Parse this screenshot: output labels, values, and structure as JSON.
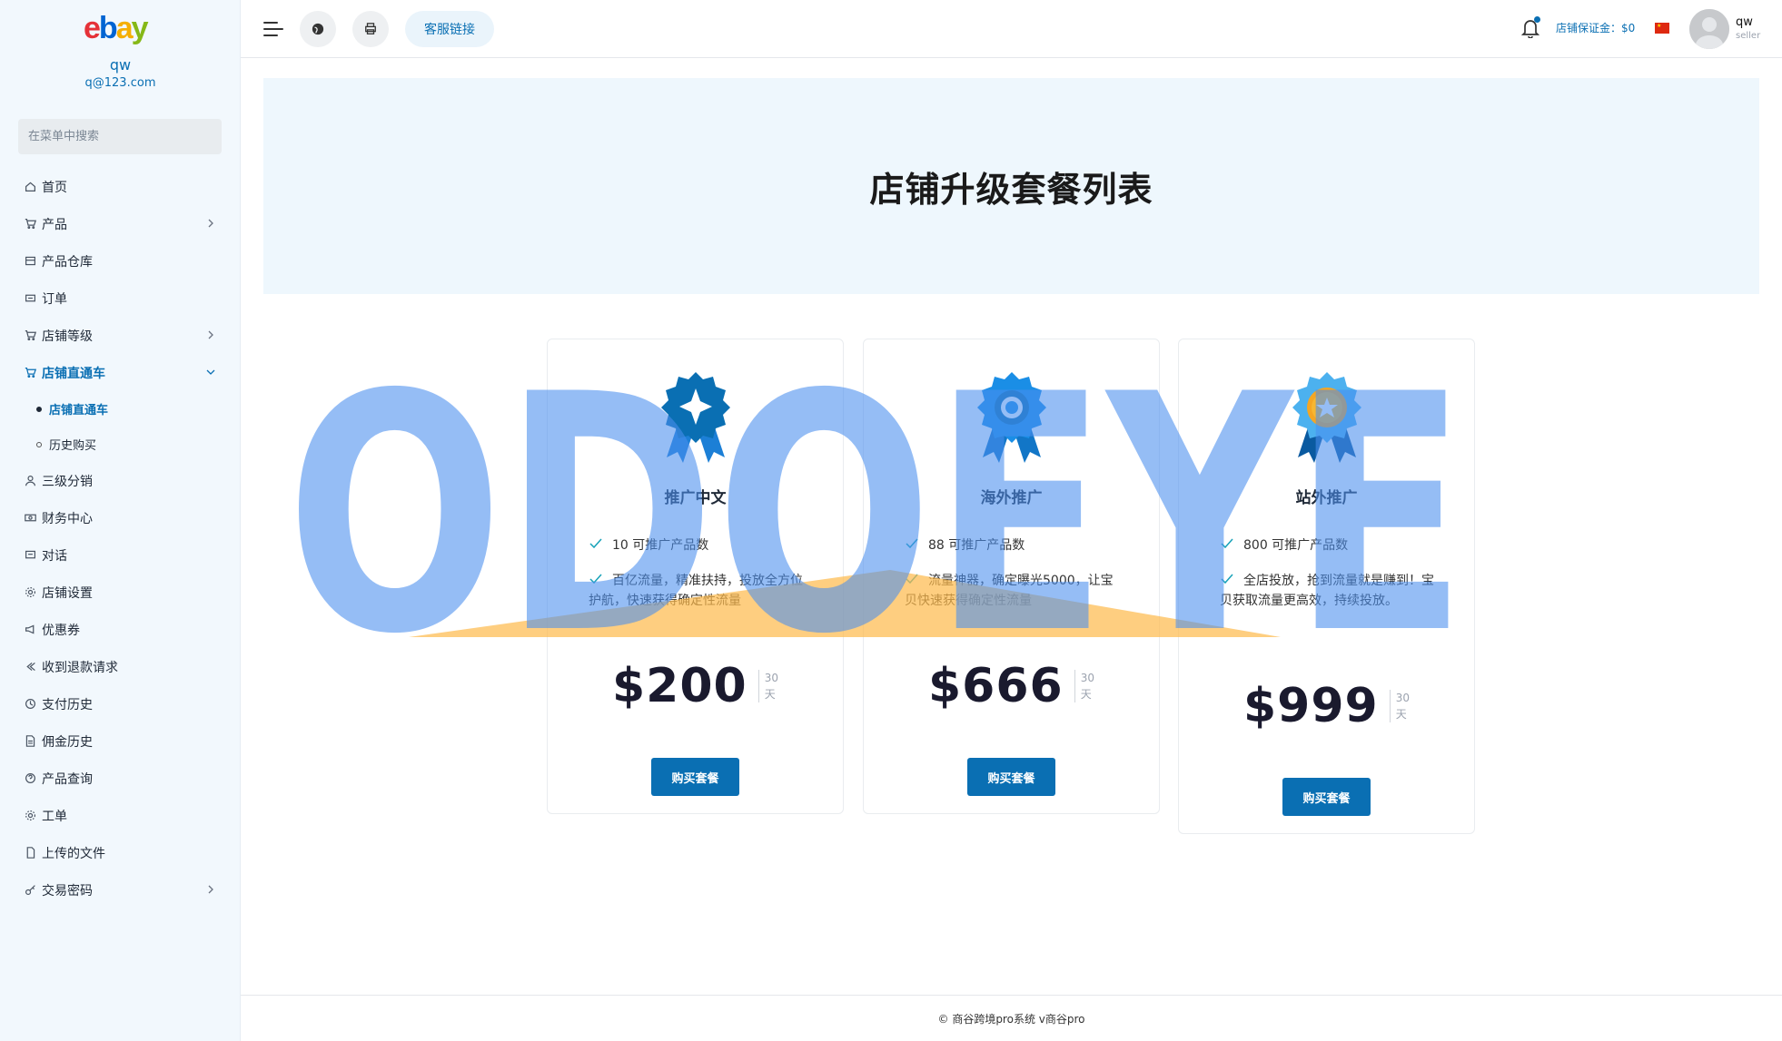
{
  "sidebar": {
    "brand": "ebay",
    "user_name": "qw",
    "user_email": "q@123.com",
    "search_placeholder": "在菜单中搜索",
    "items": [
      {
        "label": "首页",
        "icon": "home-icon"
      },
      {
        "label": "产品",
        "icon": "cart-icon",
        "expandable": true
      },
      {
        "label": "产品仓库",
        "icon": "warehouse-icon"
      },
      {
        "label": "订单",
        "icon": "order-icon"
      },
      {
        "label": "店铺等级",
        "icon": "cart-icon",
        "expandable": true
      },
      {
        "label": "店铺直通车",
        "icon": "cart-icon",
        "expanded": true,
        "active": true
      },
      {
        "label": "三级分销",
        "icon": "user-icon"
      },
      {
        "label": "财务中心",
        "icon": "money-icon"
      },
      {
        "label": "对话",
        "icon": "chat-icon"
      },
      {
        "label": "店铺设置",
        "icon": "gear-icon"
      },
      {
        "label": "优惠券",
        "icon": "megaphone-icon"
      },
      {
        "label": "收到退款请求",
        "icon": "refund-icon"
      },
      {
        "label": "支付历史",
        "icon": "history-icon"
      },
      {
        "label": "佣金历史",
        "icon": "document-icon"
      },
      {
        "label": "产品查询",
        "icon": "help-icon"
      },
      {
        "label": "工单",
        "icon": "gear-icon"
      },
      {
        "label": "上传的文件",
        "icon": "file-icon"
      },
      {
        "label": "交易密码",
        "icon": "key-icon",
        "expandable": true
      }
    ],
    "subitems": [
      {
        "label": "店铺直通车",
        "active": true
      },
      {
        "label": "历史购买",
        "active": false
      }
    ]
  },
  "header": {
    "cs_link": "客服链接",
    "deposit": "店铺保证金：$0",
    "user_name": "qw",
    "user_role": "seller",
    "notification_dot_color": "#0a6fb3"
  },
  "main": {
    "title": "店铺升级套餐列表",
    "plans": [
      {
        "name": "推广中文",
        "features": [
          "10 可推广产品数",
          "百亿流量，精准扶持，投放全方位护航，快速获得确定性流量"
        ],
        "price": "$200",
        "period_num": "30",
        "period_unit": "天",
        "buy_label": "购买套餐",
        "medal": "diamond-medal-icon"
      },
      {
        "name": "海外推广",
        "features": [
          "88 可推广产品数",
          "流量神器，确定曝光5000，让宝贝快速获得确定性流量"
        ],
        "price": "$666",
        "period_num": "30",
        "period_unit": "天",
        "buy_label": "购买套餐",
        "medal": "ring-medal-icon"
      },
      {
        "name": "站外推广",
        "features": [
          "800 可推广产品数",
          "全店投放，抢到流量就是赚到！宝贝获取流量更高效，持续投放。"
        ],
        "price": "$999",
        "period_num": "30",
        "period_unit": "天",
        "buy_label": "购买套餐",
        "medal": "star-medal-icon"
      }
    ]
  },
  "footer": {
    "copyright": "© 商谷跨境pro系统 v商谷pro"
  },
  "watermark": {
    "text": "ODOEYE"
  },
  "colors": {
    "accent": "#0a6fb3",
    "banner_bg": "#eef7fd",
    "sidebar_bg": "#f2f8fd"
  }
}
